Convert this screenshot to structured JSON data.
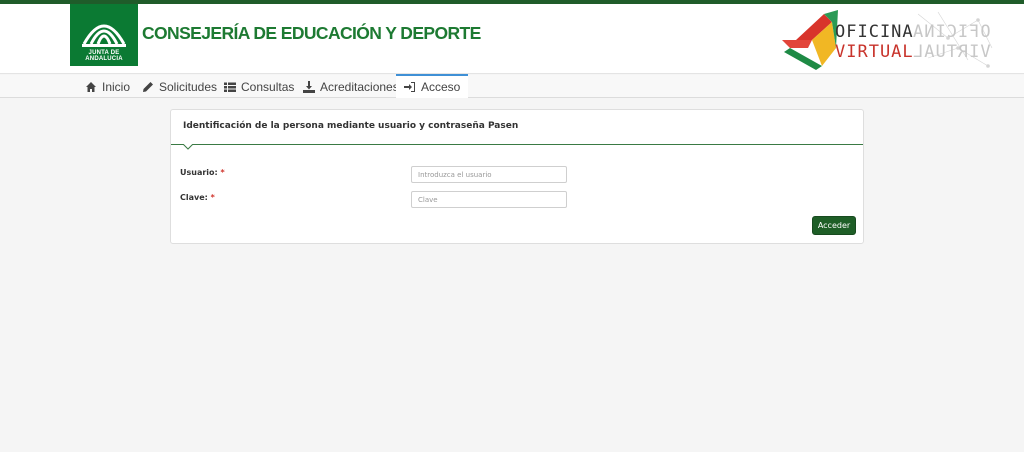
{
  "header": {
    "logo_text": "JUNTA DE ANDALUCIA",
    "department": "CONSEJERÍA DE EDUCACIÓN Y DEPORTE",
    "oficina_line1": "OFICINA",
    "oficina_line2": "VIRTUAL"
  },
  "nav": {
    "items": [
      {
        "label": "Inicio",
        "icon": "home-icon"
      },
      {
        "label": "Solicitudes",
        "icon": "pencil-icon"
      },
      {
        "label": "Consultas",
        "icon": "list-icon"
      },
      {
        "label": "Acreditaciones",
        "icon": "download-icon"
      },
      {
        "label": "Acceso",
        "icon": "sign-in-icon",
        "active": true
      }
    ]
  },
  "form": {
    "title": "Identificación de la persona mediante usuario y contraseña Pasen",
    "usuario_label": "Usuario:",
    "usuario_placeholder": "Introduzca el usuario",
    "clave_label": "Clave:",
    "clave_placeholder": "Clave",
    "required_mark": "*",
    "submit_label": "Acceder"
  },
  "colors": {
    "brand_green": "#0b7a33",
    "dark_green": "#1e5e27",
    "active_tab": "#3f90d6",
    "required_red": "#d0342c"
  }
}
